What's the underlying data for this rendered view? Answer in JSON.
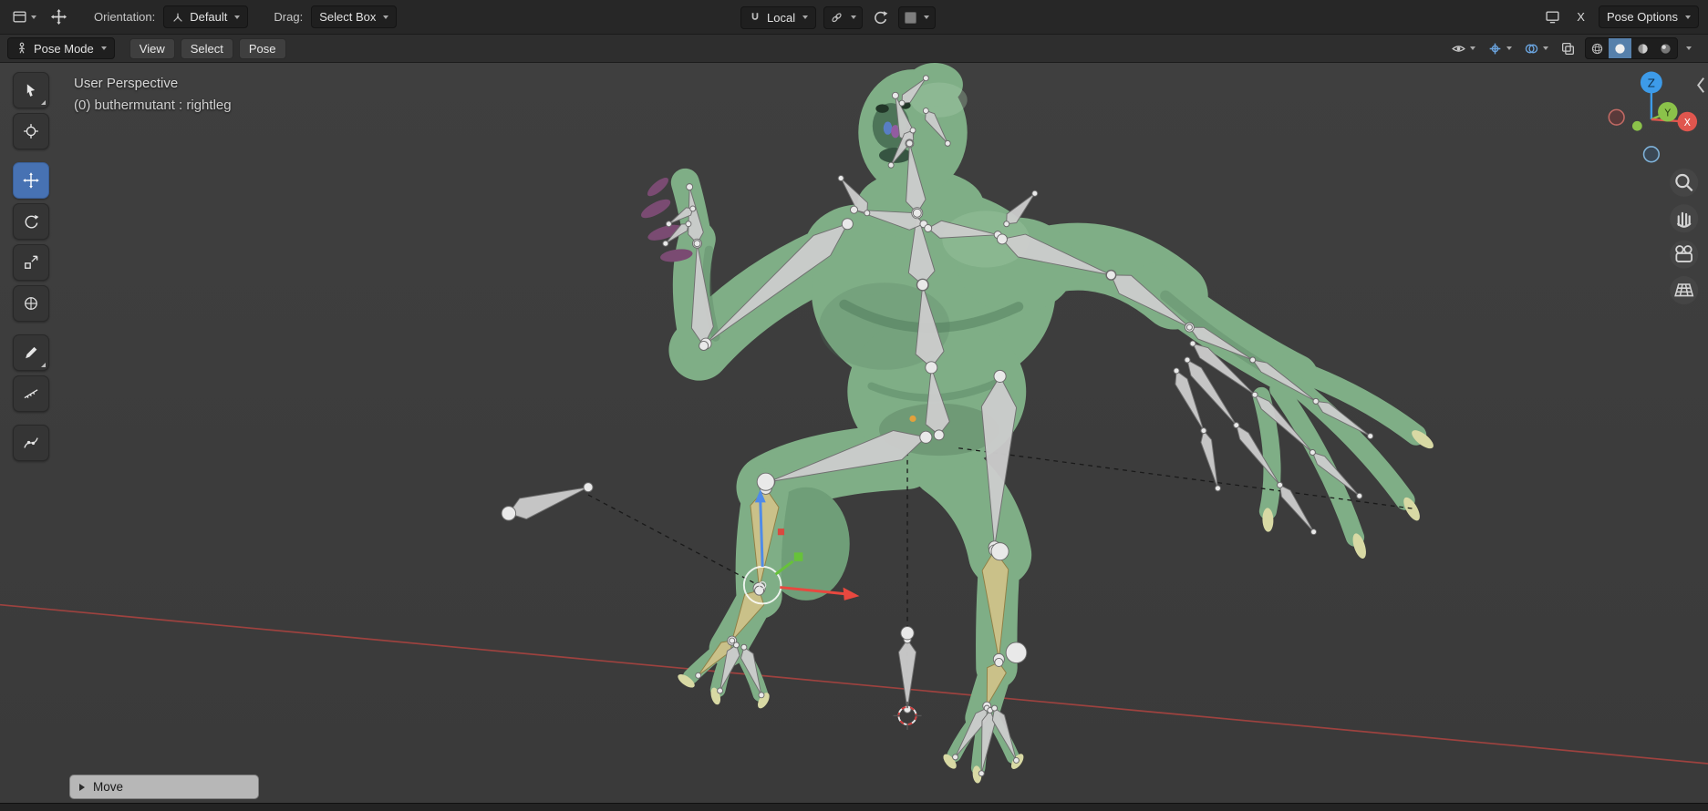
{
  "topbar": {
    "orientation_label": "Orientation:",
    "orientation_value": "Default",
    "drag_label": "Drag:",
    "drag_value": "Select Box",
    "snap_value": "Local",
    "close_label": "X",
    "pose_options_label": "Pose Options"
  },
  "header": {
    "mode_value": "Pose Mode",
    "menus": {
      "view": "View",
      "select": "Select",
      "pose": "Pose"
    }
  },
  "toolbar": {
    "active_tool": "move",
    "tools": [
      "tweak-select",
      "cursor",
      "move",
      "rotate",
      "scale",
      "transform",
      "annotate",
      "measure",
      "pose-breakdowner"
    ]
  },
  "viewport": {
    "view_label": "User Perspective",
    "object_label": "(0) buthermutant : rightleg",
    "axes": {
      "x": "X",
      "y": "Y",
      "z": "Z"
    }
  },
  "operator_panel": {
    "label": "Move"
  },
  "colors": {
    "accent_active_tool": "#4772b3",
    "axis_x": "#e0564e",
    "axis_y": "#8bc24a",
    "axis_z": "#3d9be9",
    "selected_bone": "#cfc289",
    "creature_green": "#7fae86"
  }
}
